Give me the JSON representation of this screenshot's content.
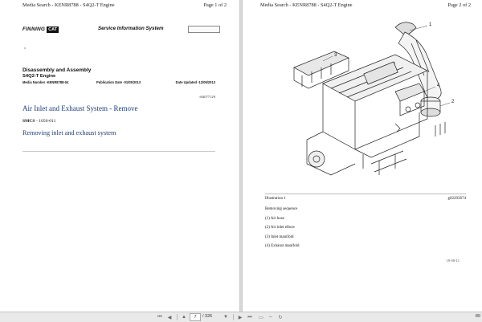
{
  "page1": {
    "header_left": "Media Search - KENR8788 - S4Q2-T Engine",
    "header_right": "Page 1 of 2",
    "logo_word": "FINNING",
    "logo_cat": "CAT",
    "service_title": "Service Information System",
    "small_mark": "x",
    "doc_title": "Disassembly and Assembly",
    "doc_subtitle": "S4Q2-T Engine",
    "media_number": "Media Number -KENR8788-04",
    "publication_date": "Publication Date -01/05/2013",
    "date_updated": "Date Updated -12/05/2013",
    "ref_id": "i04077129",
    "section_title": "Air Inlet and Exhaust System - Remove",
    "smcs_label": "SMCS",
    "smcs_value": " - 1050-011",
    "subsection_title": "Removing inlet and exhaust system"
  },
  "page2": {
    "header_left": "Media Search - KENR8788 - S4Q2-T Engine",
    "header_right": "Page 2 of 2",
    "callouts": [
      "1",
      "2",
      "3",
      "4"
    ],
    "illustration_label": "Illustration 1",
    "illustration_ref": "g02293674",
    "steps_title": "Removing sequence",
    "steps": [
      "(1) Air hose",
      "(2) Air inlet elbow",
      "(3) Inlet manifold",
      "(4) Exhaust manifold"
    ],
    "footer_date": "19-50-11"
  },
  "toolbar": {
    "current_page": "7",
    "total_pages": "/ 326",
    "zoom": "89"
  }
}
